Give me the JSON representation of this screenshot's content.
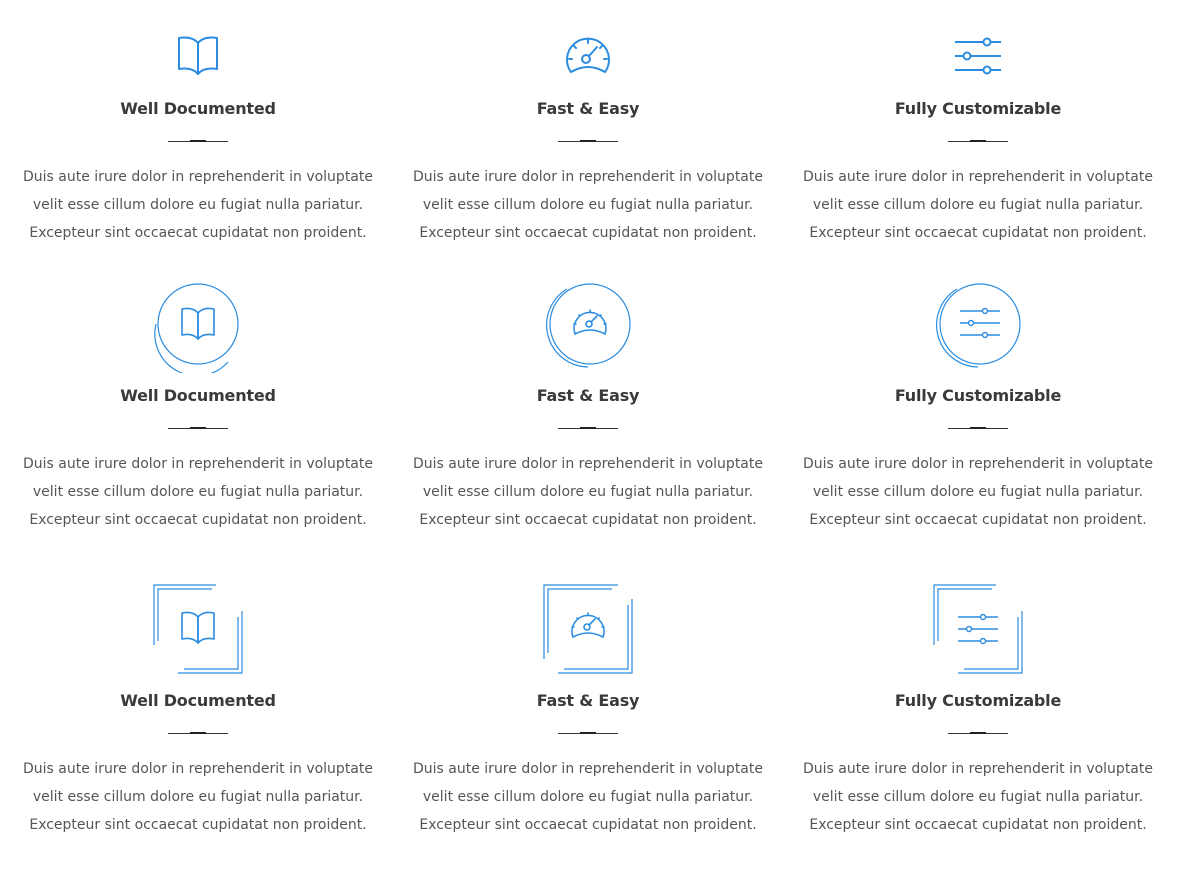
{
  "accent_color": "#2b8ce0",
  "rows": [
    {
      "style": "plain",
      "features": [
        {
          "icon": "book-icon",
          "title": "Well Documented",
          "text": "Duis aute irure dolor in reprehenderit in voluptate velit esse cillum dolore eu fugiat nulla pariatur. Excepteur sint occaecat cupidatat non proident."
        },
        {
          "icon": "speedometer-icon",
          "title": "Fast & Easy",
          "text": "Duis aute irure dolor in reprehenderit in voluptate velit esse cillum dolore eu fugiat nulla pariatur. Excepteur sint occaecat cupidatat non proident."
        },
        {
          "icon": "sliders-icon",
          "title": "Fully Customizable",
          "text": "Duis aute irure dolor in reprehenderit in voluptate velit esse cillum dolore eu fugiat nulla pariatur. Excepteur sint occaecat cupidatat non proident."
        }
      ]
    },
    {
      "style": "circle",
      "features": [
        {
          "icon": "book-icon",
          "title": "Well Documented",
          "text": "Duis aute irure dolor in reprehenderit in voluptate velit esse cillum dolore eu fugiat nulla pariatur. Excepteur sint occaecat cupidatat non proident."
        },
        {
          "icon": "speedometer-icon",
          "title": "Fast & Easy",
          "text": "Duis aute irure dolor in reprehenderit in voluptate velit esse cillum dolore eu fugiat nulla pariatur. Excepteur sint occaecat cupidatat non proident."
        },
        {
          "icon": "sliders-icon",
          "title": "Fully Customizable",
          "text": "Duis aute irure dolor in reprehenderit in voluptate velit esse cillum dolore eu fugiat nulla pariatur. Excepteur sint occaecat cupidatat non proident."
        }
      ]
    },
    {
      "style": "square",
      "features": [
        {
          "icon": "book-icon",
          "title": "Well Documented",
          "text": "Duis aute irure dolor in reprehenderit in voluptate velit esse cillum dolore eu fugiat nulla pariatur. Excepteur sint occaecat cupidatat non proident."
        },
        {
          "icon": "speedometer-icon",
          "title": "Fast & Easy",
          "text": "Duis aute irure dolor in reprehenderit in voluptate velit esse cillum dolore eu fugiat nulla pariatur. Excepteur sint occaecat cupidatat non proident."
        },
        {
          "icon": "sliders-icon",
          "title": "Fully Customizable",
          "text": "Duis aute irure dolor in reprehenderit in voluptate velit esse cillum dolore eu fugiat nulla pariatur. Excepteur sint occaecat cupidatat non proident."
        }
      ]
    }
  ]
}
